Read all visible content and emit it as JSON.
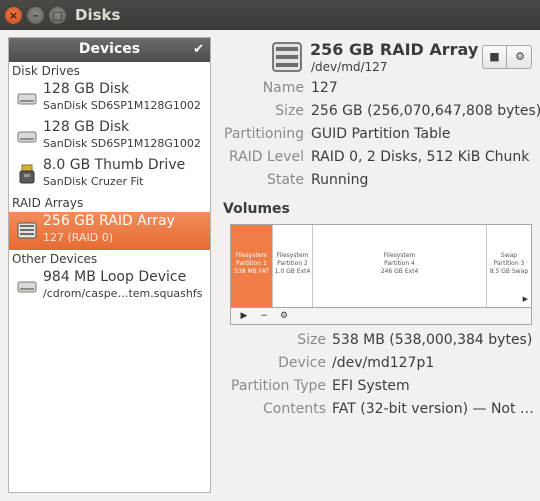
{
  "window": {
    "title": "Disks",
    "close_glyph": "×",
    "min_glyph": "–",
    "max_glyph": "□"
  },
  "sidebar": {
    "header": "Devices",
    "header_icon": "check-icon",
    "sections": [
      {
        "label": "Disk Drives"
      },
      {
        "label": "RAID Arrays"
      },
      {
        "label": "Other Devices"
      }
    ],
    "items": [
      {
        "title": "128 GB Disk",
        "subtitle": "SanDisk SD6SP1M128G1002",
        "icon": "hard-disk-icon"
      },
      {
        "title": "128 GB Disk",
        "subtitle": "SanDisk SD6SP1M128G1002",
        "icon": "hard-disk-icon"
      },
      {
        "title": "8.0 GB Thumb Drive",
        "subtitle": "SanDisk Cruzer Fit",
        "icon": "usb-drive-icon"
      },
      {
        "title": "256 GB RAID Array",
        "subtitle": "127 (RAID 0)",
        "icon": "raid-icon",
        "selected": true
      },
      {
        "title": "984 MB Loop Device",
        "subtitle": "/cdrom/caspe…tem.squashfs",
        "icon": "hard-disk-icon"
      }
    ]
  },
  "drive": {
    "title": "256 GB RAID Array",
    "device": "/dev/md/127",
    "properties": [
      {
        "label": "Name",
        "value": "127"
      },
      {
        "label": "Size",
        "value": "256 GB (256,070,647,808 bytes)"
      },
      {
        "label": "Partitioning",
        "value": "GUID Partition Table"
      },
      {
        "label": "RAID Level",
        "value": "RAID 0, 2 Disks, 512 KiB Chunk"
      },
      {
        "label": "State",
        "value": "Running"
      }
    ],
    "stop_glyph": "■",
    "gear_glyph": "⚙"
  },
  "volumes": {
    "label": "Volumes",
    "segments": [
      {
        "name": "Filesystem",
        "part": "Partition 1",
        "size": "538 MB FAT",
        "selected": true
      },
      {
        "name": "Filesystem",
        "part": "Partition 2",
        "size": "1.0 GB Ext4"
      },
      {
        "name": "Filesystem",
        "part": "Partition 4",
        "size": "246 GB Ext4"
      },
      {
        "name": "Swap",
        "part": "Partition 3",
        "size": "8.5 GB Swap"
      }
    ],
    "toolbar": {
      "play": "▶",
      "minus": "−",
      "settings": "⚙"
    },
    "scroll_glyph": "▶",
    "properties": [
      {
        "label": "Size",
        "value": "538 MB (538,000,384 bytes)"
      },
      {
        "label": "Device",
        "value": "/dev/md127p1"
      },
      {
        "label": "Partition Type",
        "value": "EFI System"
      },
      {
        "label": "Contents",
        "value": "FAT (32-bit version) — Not …"
      }
    ]
  },
  "colors": {
    "accent": "#e66b32",
    "titlebar": "#3c3b37",
    "window_bg": "#f2f1f0"
  }
}
